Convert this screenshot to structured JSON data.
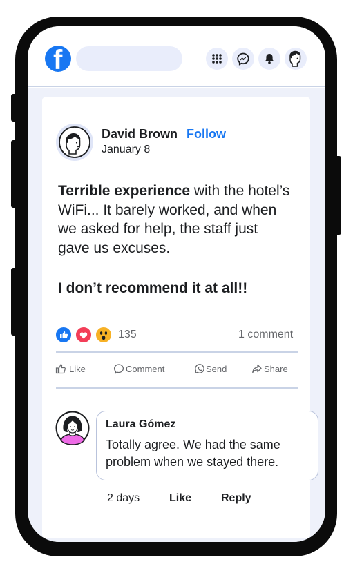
{
  "header": {
    "search_placeholder": "",
    "icons": [
      "facebook-logo-icon",
      "apps-grid-icon",
      "messenger-icon",
      "notifications-bell-icon",
      "profile-avatar-icon"
    ]
  },
  "post": {
    "author": "David Brown",
    "follow_label": "Follow",
    "date": "January 8",
    "text_bold": "Terrible experience",
    "text_rest": " with the hotel’s WiFi... It barely worked, and when we asked for help, the staff just gave us excuses.",
    "text_second": "I don’t recommend it at all!!",
    "reaction_count": "135",
    "comment_count": "1 comment",
    "reactions": [
      "like",
      "love",
      "wow"
    ]
  },
  "actions": {
    "like": "Like",
    "comment": "Comment",
    "send": "Send",
    "share": "Share"
  },
  "comment": {
    "author": "Laura Gómez",
    "text": "Totally agree. We had the same problem when we stayed there.",
    "time": "2 days",
    "like": "Like",
    "reply": "Reply"
  },
  "colors": {
    "brand_blue": "#1877f2",
    "love_red": "#f33e58",
    "wow_yellow": "#f7b125",
    "feed_bg": "#eef1fa",
    "frame": "#0b0b0b"
  }
}
